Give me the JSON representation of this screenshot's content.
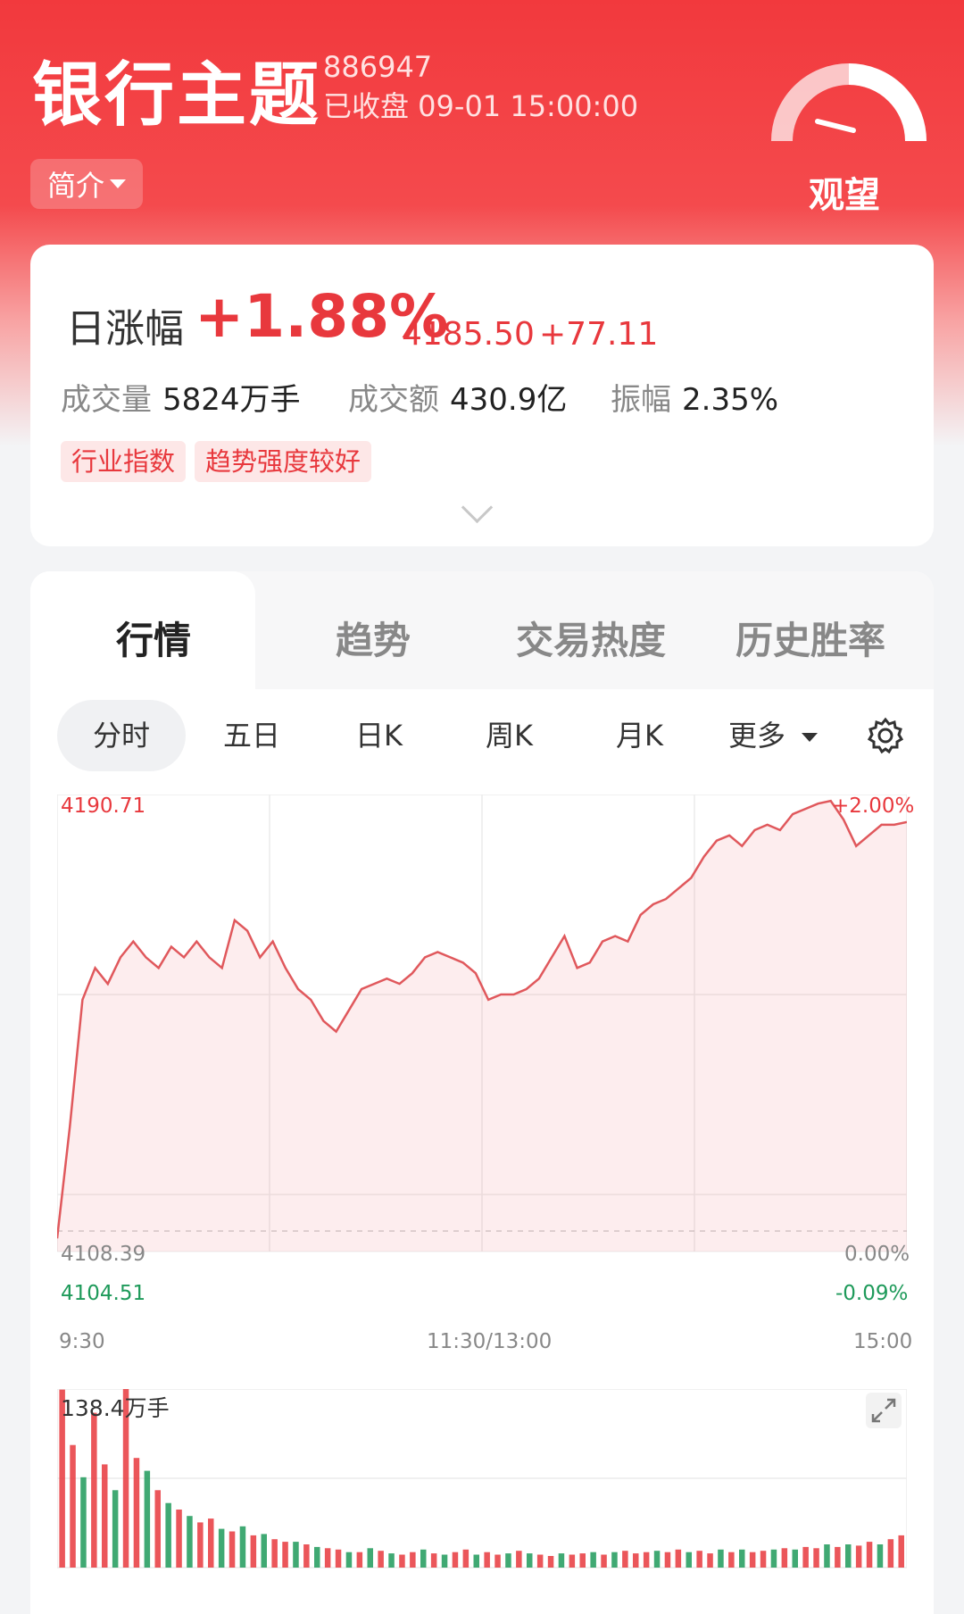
{
  "header": {
    "title": "银行主题",
    "code": "886947",
    "status": "已收盘 09-01 15:00:00",
    "intro_button": "简介",
    "sentiment": "观望",
    "colors": {
      "brand": "#f2393d",
      "up": "#e8383d",
      "down": "#1e9a5a"
    }
  },
  "summary": {
    "label": "日涨幅",
    "change_pct": "+1.88%",
    "price": "4185.50",
    "change": "+77.11",
    "volume_label": "成交量",
    "volume": "5824万手",
    "turnover_label": "成交额",
    "turnover": "430.9亿",
    "amplitude_label": "振幅",
    "amplitude": "2.35%",
    "tags": [
      "行业指数",
      "趋势强度较好"
    ]
  },
  "tabs": [
    "行情",
    "趋势",
    "交易热度",
    "历史胜率"
  ],
  "subtabs": [
    "分时",
    "五日",
    "日K",
    "周K",
    "月K",
    "更多"
  ],
  "icons": [
    "chevron-down-icon",
    "gauge-icon",
    "gear-icon",
    "expand-icon"
  ],
  "chart_data": [
    {
      "type": "line",
      "title": "",
      "x_ticks": [
        "9:30",
        "11:30/13:00",
        "15:00"
      ],
      "y_labels_left": {
        "high": "4190.71",
        "base": "4108.39",
        "low": "4104.51"
      },
      "y_labels_right": {
        "high": "+2.00%",
        "base": "0.00%",
        "low": "-0.09%"
      },
      "ylim": [
        4104.51,
        4190.71
      ],
      "baseline": 4108.39,
      "series": [
        {
          "values": [
            4107,
            4128,
            4152,
            4158,
            4155,
            4160,
            4163,
            4160,
            4158,
            4162,
            4160,
            4163,
            4160,
            4158,
            4167,
            4165,
            4160,
            4163,
            4158,
            4154,
            4152,
            4148,
            4146,
            4150,
            4154,
            4155,
            4156,
            4155,
            4157,
            4160,
            4161,
            4160,
            4159,
            4157,
            4152,
            4153,
            4153,
            4154,
            4156,
            4160,
            4164,
            4158,
            4159,
            4163,
            4164,
            4163,
            4168,
            4170,
            4171,
            4173,
            4175,
            4179,
            4182,
            4183,
            4181,
            4184,
            4185,
            4184,
            4187,
            4188,
            4189,
            4189.5,
            4186,
            4181,
            4183,
            4185,
            4185,
            4185.5
          ]
        }
      ]
    },
    {
      "type": "bar",
      "title": "",
      "ylabel": "138.4万手",
      "ylim": [
        0,
        138.4
      ],
      "values": [
        138,
        95,
        70,
        120,
        80,
        60,
        140,
        85,
        75,
        60,
        50,
        45,
        40,
        35,
        38,
        30,
        28,
        32,
        25,
        26,
        22,
        20,
        20,
        18,
        16,
        15,
        14,
        12,
        12,
        15,
        13,
        11,
        10,
        12,
        14,
        11,
        10,
        12,
        14,
        10,
        12,
        10,
        11,
        13,
        11,
        10,
        9,
        11,
        10,
        11,
        12,
        10,
        12,
        13,
        11,
        12,
        13,
        12,
        14,
        12,
        13,
        11,
        14,
        12,
        14,
        12,
        13,
        14,
        15,
        14,
        16,
        15,
        18,
        16,
        18,
        17,
        20,
        18,
        22,
        25
      ],
      "up": [
        true,
        true,
        false,
        true,
        true,
        false,
        true,
        true,
        false,
        true,
        false,
        true,
        false,
        true,
        true,
        false,
        true,
        false,
        true,
        false,
        true,
        true,
        false,
        true,
        false,
        true,
        true,
        false,
        true,
        false,
        true,
        false,
        true,
        true,
        false,
        true,
        false,
        true,
        true,
        false,
        true,
        true,
        false,
        true,
        false,
        true,
        true,
        false,
        true,
        true,
        false,
        true,
        false,
        true,
        true,
        true,
        false,
        true,
        true,
        false,
        true,
        true,
        false,
        true,
        false,
        true,
        true,
        false,
        true,
        false,
        true,
        true,
        false,
        true,
        false,
        true,
        true,
        false,
        true,
        true
      ]
    }
  ]
}
